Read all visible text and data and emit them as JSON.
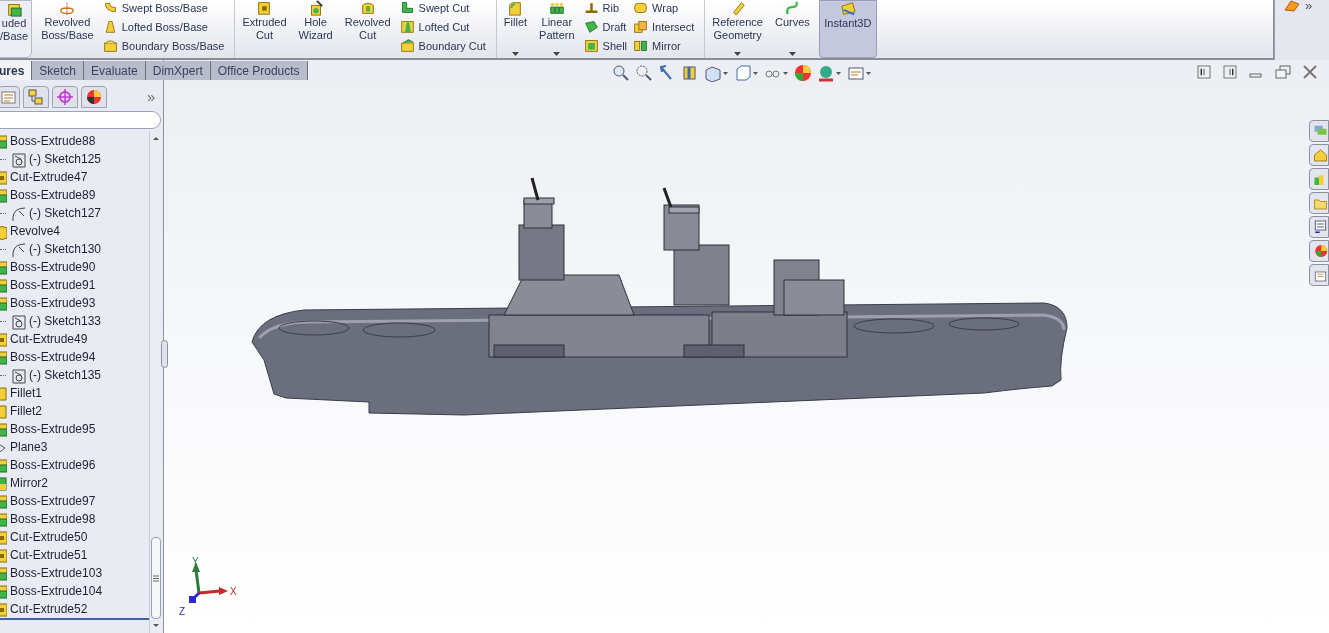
{
  "ribbon": {
    "groups": [
      {
        "tools": [
          {
            "kind": "large",
            "lines": [
              "uded",
              "/Base"
            ],
            "selected": false,
            "dropdown": false
          },
          {
            "kind": "large",
            "lines": [
              "Revolved",
              "Boss/Base"
            ],
            "selected": false,
            "dropdown": false
          },
          {
            "kind": "stack",
            "items": [
              {
                "label": "Swept Boss/Base"
              },
              {
                "label": "Lofted Boss/Base"
              },
              {
                "label": "Boundary Boss/Base"
              }
            ]
          }
        ]
      },
      {
        "tools": [
          {
            "kind": "large",
            "lines": [
              "Extruded",
              "Cut"
            ],
            "selected": false,
            "dropdown": false
          },
          {
            "kind": "large",
            "lines": [
              "Hole",
              "Wizard"
            ],
            "selected": false,
            "dropdown": false
          },
          {
            "kind": "large",
            "lines": [
              "Revolved",
              "Cut"
            ],
            "selected": false,
            "dropdown": false
          },
          {
            "kind": "stack",
            "items": [
              {
                "label": "Swept Cut"
              },
              {
                "label": "Lofted Cut"
              },
              {
                "label": "Boundary Cut"
              }
            ]
          }
        ]
      },
      {
        "tools": [
          {
            "kind": "large",
            "lines": [
              "Fillet"
            ],
            "selected": false,
            "dropdown": true
          },
          {
            "kind": "large",
            "lines": [
              "Linear",
              "Pattern"
            ],
            "selected": false,
            "dropdown": true
          },
          {
            "kind": "stack",
            "items": [
              {
                "label": "Rib"
              },
              {
                "label": "Draft"
              },
              {
                "label": "Shell"
              }
            ]
          },
          {
            "kind": "stack",
            "items": [
              {
                "label": "Wrap"
              },
              {
                "label": "Intersect"
              },
              {
                "label": "Mirror"
              }
            ]
          }
        ]
      },
      {
        "tools": [
          {
            "kind": "large",
            "lines": [
              "Reference",
              "Geometry"
            ],
            "selected": false,
            "dropdown": true
          },
          {
            "kind": "large",
            "lines": [
              "Curves"
            ],
            "selected": false,
            "dropdown": true
          },
          {
            "kind": "large",
            "lines": [
              "Instant3D"
            ],
            "selected": true,
            "dropdown": false
          }
        ]
      }
    ],
    "overflow": "»"
  },
  "tabs": [
    {
      "label": "ures",
      "selected": true
    },
    {
      "label": "Sketch",
      "selected": false
    },
    {
      "label": "Evaluate",
      "selected": false
    },
    {
      "label": "DimXpert",
      "selected": false
    },
    {
      "label": "Office Products",
      "selected": false
    }
  ],
  "panel": {
    "expand": "»"
  },
  "tree": [
    {
      "kind": "boss",
      "label": "Boss-Extrude88",
      "children": [
        {
          "kind": "sketch",
          "label": "(-) Sketch125"
        }
      ]
    },
    {
      "kind": "cut",
      "label": "Cut-Extrude47"
    },
    {
      "kind": "boss",
      "label": "Boss-Extrude89",
      "children": [
        {
          "kind": "sketch2",
          "label": "(-) Sketch127"
        }
      ]
    },
    {
      "kind": "revolve",
      "label": "Revolve4",
      "children": [
        {
          "kind": "sketch2",
          "label": "(-) Sketch130"
        }
      ]
    },
    {
      "kind": "boss",
      "label": "Boss-Extrude90"
    },
    {
      "kind": "boss",
      "label": "Boss-Extrude91"
    },
    {
      "kind": "boss",
      "label": "Boss-Extrude93",
      "children": [
        {
          "kind": "sketch",
          "label": "(-) Sketch133"
        }
      ]
    },
    {
      "kind": "cut",
      "label": "Cut-Extrude49"
    },
    {
      "kind": "boss",
      "label": "Boss-Extrude94",
      "children": [
        {
          "kind": "sketch",
          "label": "(-) Sketch135"
        }
      ]
    },
    {
      "kind": "fillet",
      "label": "Fillet1"
    },
    {
      "kind": "fillet",
      "label": "Fillet2"
    },
    {
      "kind": "boss",
      "label": "Boss-Extrude95"
    },
    {
      "kind": "plane",
      "label": "Plane3"
    },
    {
      "kind": "boss",
      "label": "Boss-Extrude96"
    },
    {
      "kind": "mirror",
      "label": "Mirror2"
    },
    {
      "kind": "boss",
      "label": "Boss-Extrude97"
    },
    {
      "kind": "boss",
      "label": "Boss-Extrude98"
    },
    {
      "kind": "cut",
      "label": "Cut-Extrude50"
    },
    {
      "kind": "cut",
      "label": "Cut-Extrude51"
    },
    {
      "kind": "boss",
      "label": "Boss-Extrude103"
    },
    {
      "kind": "boss",
      "label": "Boss-Extrude104"
    },
    {
      "kind": "cut",
      "label": "Cut-Extrude52"
    }
  ],
  "triad": {
    "labels": [
      "X",
      "Y",
      "Z"
    ]
  }
}
